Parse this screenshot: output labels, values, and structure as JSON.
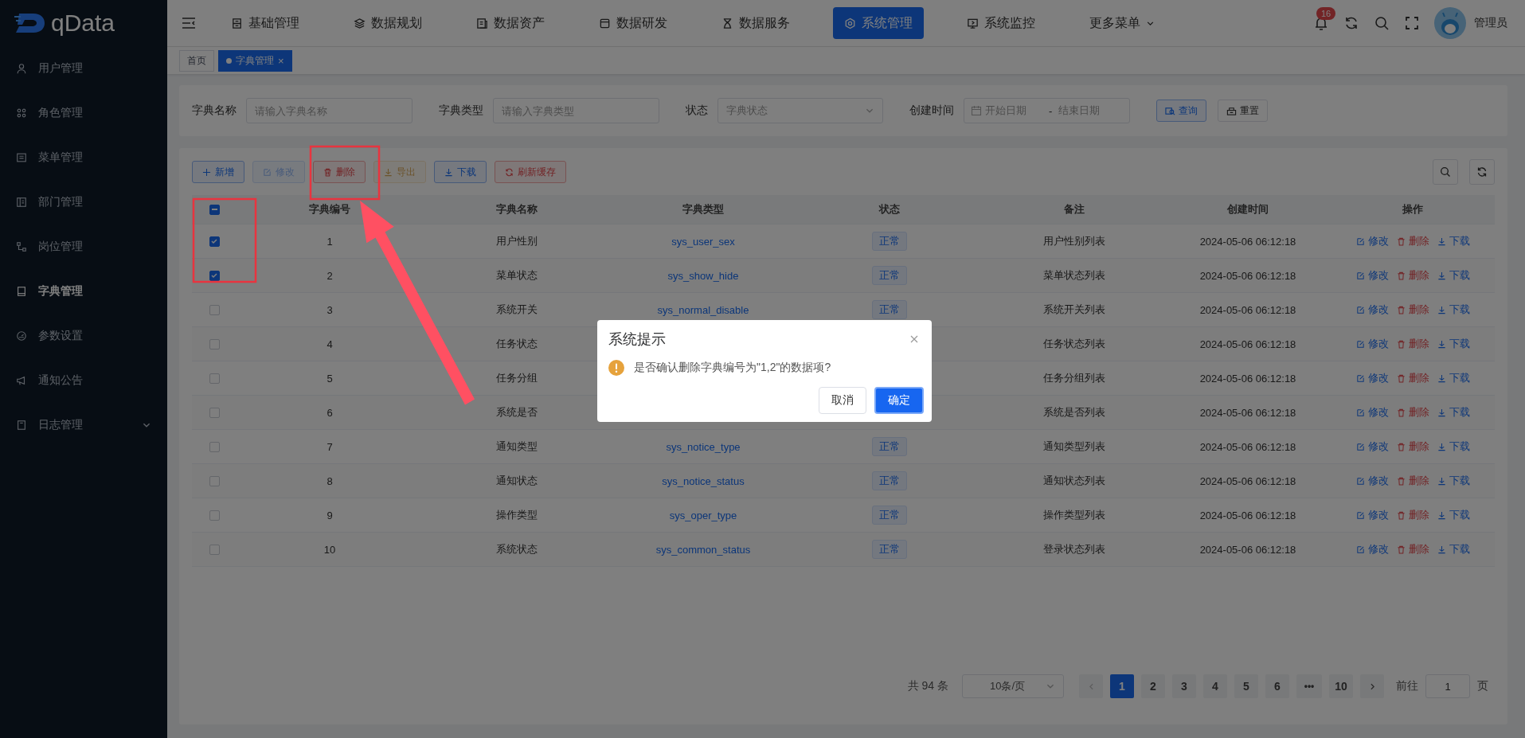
{
  "logo": {
    "text": "qData"
  },
  "top_nav": [
    {
      "label": "基础管理",
      "kind": "link",
      "selected": false
    },
    {
      "label": "数据规划",
      "kind": "link",
      "selected": false
    },
    {
      "label": "数据资产",
      "kind": "link",
      "selected": false
    },
    {
      "label": "数据研发",
      "kind": "link",
      "selected": false
    },
    {
      "label": "数据服务",
      "kind": "link",
      "selected": false
    },
    {
      "label": "系统管理",
      "kind": "link",
      "selected": true
    },
    {
      "label": "系统监控",
      "kind": "link",
      "selected": false
    },
    {
      "label": "更多菜单",
      "kind": "dropdown",
      "selected": false
    }
  ],
  "header_right": {
    "notification_count": "16",
    "user": "管理员"
  },
  "sidebar": {
    "items": [
      {
        "label": "用户管理",
        "kind": "link",
        "selected": false
      },
      {
        "label": "角色管理",
        "kind": "link",
        "selected": false
      },
      {
        "label": "菜单管理",
        "kind": "link",
        "selected": false
      },
      {
        "label": "部门管理",
        "kind": "link",
        "selected": false
      },
      {
        "label": "岗位管理",
        "kind": "link",
        "selected": false
      },
      {
        "label": "字典管理",
        "kind": "link",
        "selected": true
      },
      {
        "label": "参数设置",
        "kind": "link",
        "selected": false
      },
      {
        "label": "通知公告",
        "kind": "link",
        "selected": false
      },
      {
        "label": "日志管理",
        "kind": "group",
        "selected": false
      }
    ]
  },
  "tabs": [
    {
      "label": "首页",
      "selected": false
    },
    {
      "label": "字典管理",
      "selected": true,
      "close": "×"
    }
  ],
  "filters": [
    {
      "label": "字典名称",
      "kind": "input",
      "placeholder": "请输入字典名称"
    },
    {
      "label": "字典类型",
      "kind": "input",
      "placeholder": "请输入字典类型"
    },
    {
      "label": "状态",
      "kind": "select",
      "placeholder": "字典状态"
    },
    {
      "label": "创建时间",
      "kind": "daterange",
      "placeholder": "开始日期",
      "placeholder_end": "结束日期",
      "separator": "-"
    }
  ],
  "filter_buttons": [
    {
      "label": "查询",
      "kind": "primary"
    },
    {
      "label": "重置",
      "kind": "default"
    }
  ],
  "toolbar": [
    {
      "label": "新增",
      "kind": "primary",
      "disabled": false
    },
    {
      "label": "修改",
      "kind": "success",
      "disabled": true
    },
    {
      "label": "删除",
      "kind": "danger",
      "disabled": false
    },
    {
      "label": "导出",
      "kind": "warning",
      "disabled": true
    },
    {
      "label": "下载",
      "kind": "primary",
      "disabled": false
    },
    {
      "label": "刷新缓存",
      "kind": "danger",
      "disabled": false
    }
  ],
  "table": {
    "select_all": {
      "indeterminate": true
    },
    "columns": [
      "字典编号",
      "字典名称",
      "字典类型",
      "状态",
      "备注",
      "创建时间",
      "操作"
    ],
    "rows": [
      {
        "checked": true,
        "id": "1",
        "name": "用户性别",
        "type": "sys_user_sex",
        "status": "正常",
        "remark": "用户性别列表",
        "created": "2024-05-06 06:12:18",
        "actions": [
          {
            "kind": "edit",
            "label": "修改"
          },
          {
            "kind": "delete",
            "label": "删除"
          },
          {
            "kind": "download",
            "label": "下载"
          }
        ]
      },
      {
        "checked": true,
        "id": "2",
        "name": "菜单状态",
        "type": "sys_show_hide",
        "status": "正常",
        "remark": "菜单状态列表",
        "created": "2024-05-06 06:12:18",
        "actions": [
          {
            "kind": "edit",
            "label": "修改"
          },
          {
            "kind": "delete",
            "label": "删除"
          },
          {
            "kind": "download",
            "label": "下载"
          }
        ]
      },
      {
        "checked": false,
        "id": "3",
        "name": "系统开关",
        "type": "sys_normal_disable",
        "status": "正常",
        "remark": "系统开关列表",
        "created": "2024-05-06 06:12:18",
        "actions": [
          {
            "kind": "edit",
            "label": "修改"
          },
          {
            "kind": "delete",
            "label": "删除"
          },
          {
            "kind": "download",
            "label": "下载"
          }
        ]
      },
      {
        "checked": false,
        "id": "4",
        "name": "任务状态",
        "remark": "任务状态列表",
        "created": "2024-05-06 06:12:18",
        "actions": [
          {
            "kind": "edit",
            "label": "修改"
          },
          {
            "kind": "delete",
            "label": "删除"
          },
          {
            "kind": "download",
            "label": "下载"
          }
        ]
      },
      {
        "checked": false,
        "id": "5",
        "name": "任务分组",
        "remark": "任务分组列表",
        "created": "2024-05-06 06:12:18",
        "actions": [
          {
            "kind": "edit",
            "label": "修改"
          },
          {
            "kind": "delete",
            "label": "删除"
          },
          {
            "kind": "download",
            "label": "下载"
          }
        ]
      },
      {
        "checked": false,
        "id": "6",
        "name": "系统是否",
        "remark": "系统是否列表",
        "created": "2024-05-06 06:12:18",
        "actions": [
          {
            "kind": "edit",
            "label": "修改"
          },
          {
            "kind": "delete",
            "label": "删除"
          },
          {
            "kind": "download",
            "label": "下载"
          }
        ]
      },
      {
        "checked": false,
        "id": "7",
        "name": "通知类型",
        "type": "sys_notice_type",
        "status": "正常",
        "remark": "通知类型列表",
        "created": "2024-05-06 06:12:18",
        "actions": [
          {
            "kind": "edit",
            "label": "修改"
          },
          {
            "kind": "delete",
            "label": "删除"
          },
          {
            "kind": "download",
            "label": "下载"
          }
        ]
      },
      {
        "checked": false,
        "id": "8",
        "name": "通知状态",
        "type": "sys_notice_status",
        "status": "正常",
        "remark": "通知状态列表",
        "created": "2024-05-06 06:12:18",
        "actions": [
          {
            "kind": "edit",
            "label": "修改"
          },
          {
            "kind": "delete",
            "label": "删除"
          },
          {
            "kind": "download",
            "label": "下载"
          }
        ]
      },
      {
        "checked": false,
        "id": "9",
        "name": "操作类型",
        "type": "sys_oper_type",
        "status": "正常",
        "remark": "操作类型列表",
        "created": "2024-05-06 06:12:18",
        "actions": [
          {
            "kind": "edit",
            "label": "修改"
          },
          {
            "kind": "delete",
            "label": "删除"
          },
          {
            "kind": "download",
            "label": "下载"
          }
        ]
      },
      {
        "checked": false,
        "id": "10",
        "name": "系统状态",
        "type": "sys_common_status",
        "status": "正常",
        "remark": "登录状态列表",
        "created": "2024-05-06 06:12:18",
        "actions": [
          {
            "kind": "edit",
            "label": "修改"
          },
          {
            "kind": "delete",
            "label": "删除"
          },
          {
            "kind": "download",
            "label": "下载"
          }
        ]
      }
    ]
  },
  "pagination": {
    "total": "共 94 条",
    "page_size": "10条/页",
    "pages": [
      {
        "label": "1",
        "kind": "page",
        "selected": true
      },
      {
        "label": "2",
        "kind": "page",
        "selected": false
      },
      {
        "label": "3",
        "kind": "page",
        "selected": false
      },
      {
        "label": "4",
        "kind": "page",
        "selected": false
      },
      {
        "label": "5",
        "kind": "page",
        "selected": false
      },
      {
        "label": "6",
        "kind": "page",
        "selected": false
      },
      {
        "label": "•••",
        "kind": "more",
        "selected": false
      },
      {
        "label": "10",
        "kind": "page",
        "selected": false
      }
    ],
    "goto_label": "前往",
    "goto_value": "1",
    "goto_suffix": "页"
  },
  "dialog": {
    "title": "系统提示",
    "message": "是否确认删除字典编号为\"1,2\"的数据项?",
    "buttons": [
      {
        "label": "取消",
        "kind": "default"
      },
      {
        "label": "确定",
        "kind": "primary"
      }
    ]
  }
}
